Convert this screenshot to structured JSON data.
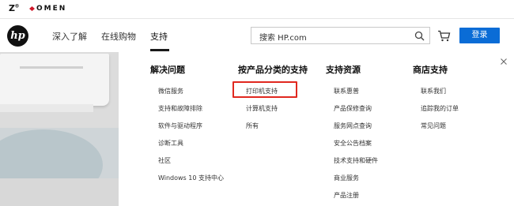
{
  "brand": {
    "z_label": "Z",
    "omen_label": "OMEN"
  },
  "nav": {
    "logo_text": "hp",
    "items": [
      "深入了解",
      "在线购物",
      "支持"
    ],
    "active_index": 2,
    "search_placeholder": "搜索 HP.com",
    "login_label": "登录"
  },
  "menu": {
    "columns": [
      {
        "title": "解决问题",
        "items": [
          "微信服务",
          "支持和故障排除",
          "软件与驱动程序",
          "诊断工具",
          "社区",
          "Windows 10 支持中心"
        ]
      },
      {
        "title": "按产品分类的支持",
        "items": [
          "打印机支持",
          "计算机支持",
          "所有"
        ]
      },
      {
        "title": "支持资源",
        "items": [
          "联系惠普",
          "产品保修查询",
          "服务网点查询",
          "安全公告档案",
          "技术支持和硬件",
          "商业服务",
          "产品注册"
        ]
      },
      {
        "title": "商店支持",
        "items": [
          "联系我们",
          "追踪我的订单",
          "常见问题"
        ]
      }
    ],
    "highlighted_item": "打印机支持"
  },
  "colors": {
    "accent": "#0a6cd6",
    "highlight_border": "#e0281f"
  }
}
